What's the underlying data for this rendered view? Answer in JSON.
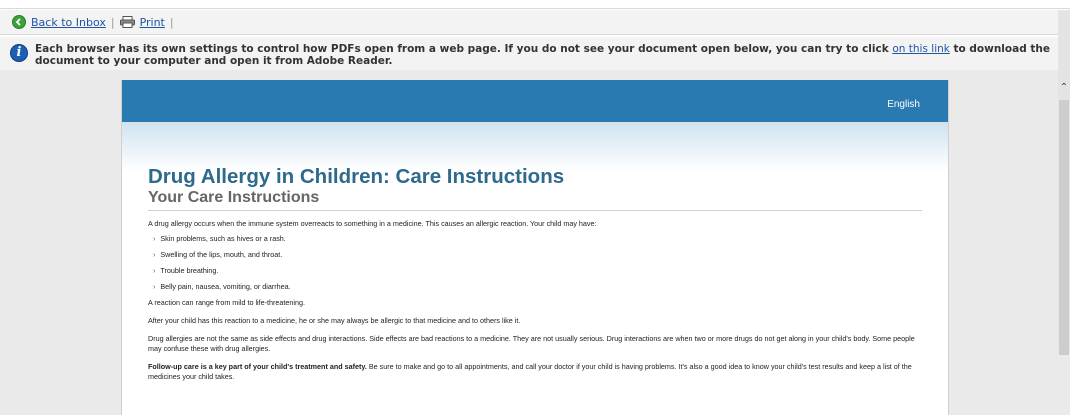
{
  "toolbar": {
    "back_label": "Back to Inbox",
    "print_label": "Print",
    "separator": "|"
  },
  "notice": {
    "text_before": "Each browser has its own settings to control how PDFs open from a web page. If you do not see your document open below, you can try to click ",
    "link_text": "on this link",
    "text_after": " to download the document to your computer and open it from Adobe Reader."
  },
  "document": {
    "language": "English",
    "title": "Drug Allergy in Children: Care Instructions",
    "subtitle": "Your Care Instructions",
    "intro": "A drug allergy occurs when the immune system overreacts to something in a medicine. This causes an allergic reaction. Your child may have:",
    "symptoms": [
      "Skin problems, such as hives or a rash.",
      "Swelling of the lips, mouth, and throat.",
      "Trouble breathing.",
      "Belly pain, nausea, vomiting, or diarrhea."
    ],
    "range": "A reaction can range from mild to life-threatening.",
    "after": "After your child has this reaction to a medicine, he or she may always be allergic to that medicine and to others like it.",
    "not_same": "Drug allergies are not the same as side effects and drug interactions. Side effects are bad reactions to a medicine. They are not usually serious. Drug interactions are when two or more drugs do not get along in your child's body. Some people may confuse these with drug allergies.",
    "followup_bold": "Follow-up care is a key part of your child's treatment and safety.",
    "followup_rest": " Be sure to make and go to all appointments, and call your doctor if your child is having problems. It's also a good idea to know your child's test results and keep a list of the medicines your child takes."
  },
  "icons": {
    "back": "back-arrow-icon",
    "print": "printer-icon",
    "info": "info-icon",
    "bullet": "chevron-right-icon",
    "scroll_up": "scroll-up-icon"
  },
  "colors": {
    "header_blue": "#2a7ab2",
    "title_blue": "#2e6a8c",
    "link_blue": "#1f55a5"
  }
}
